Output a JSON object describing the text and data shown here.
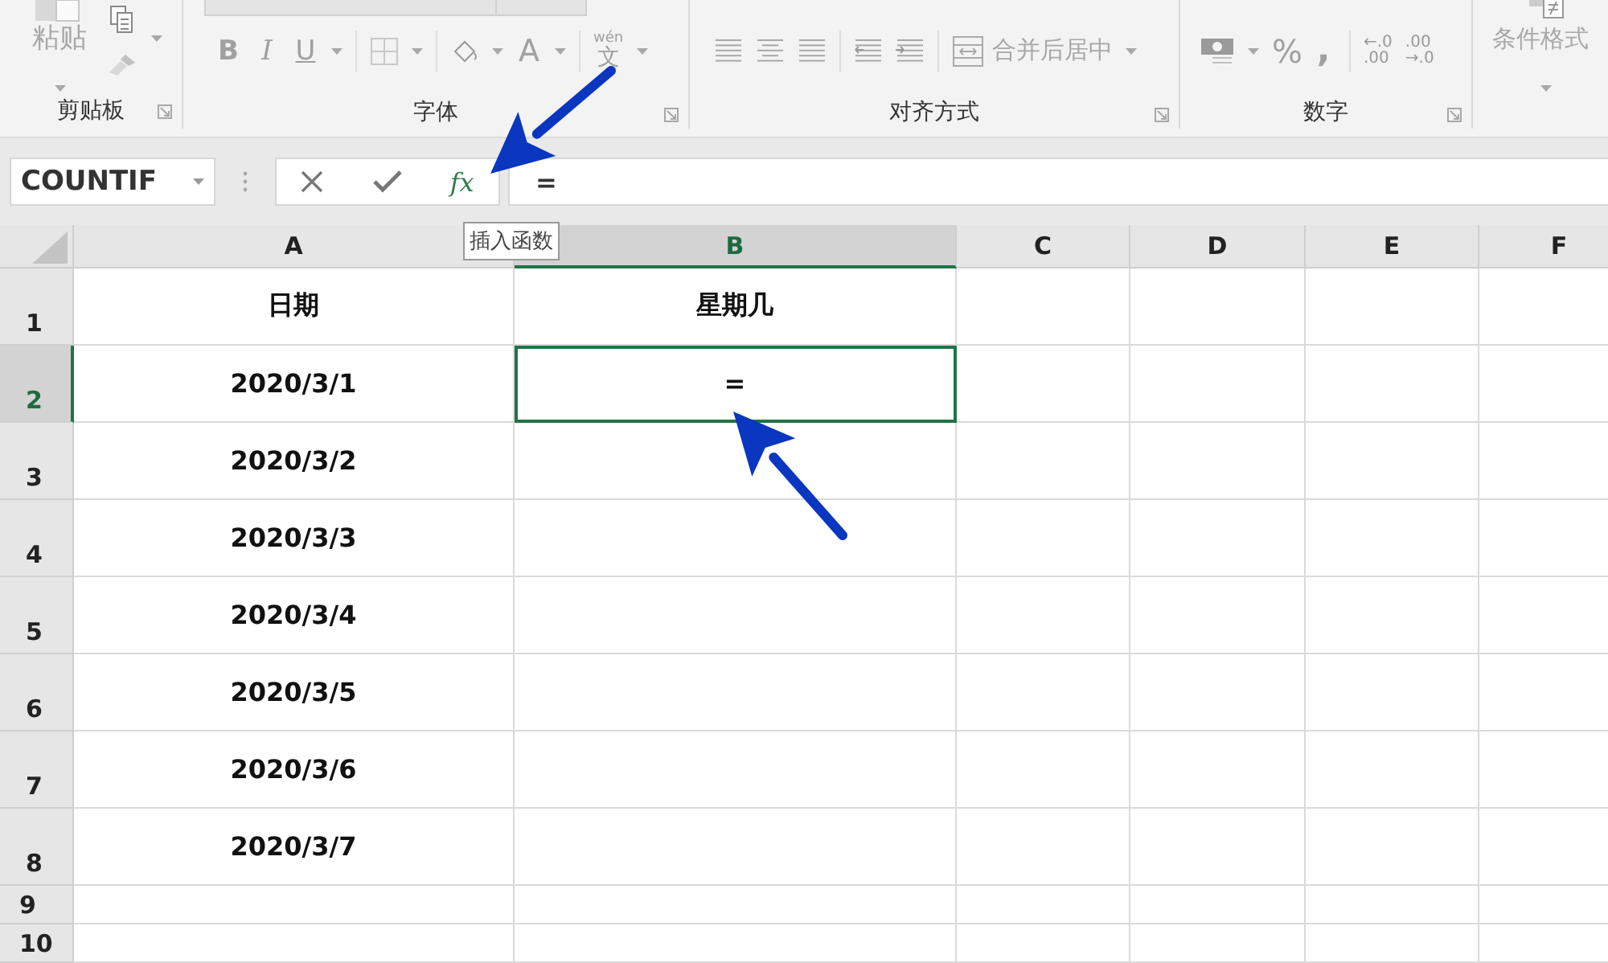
{
  "ribbon": {
    "groups": [
      {
        "kind": "clipboard",
        "label": "剪贴板",
        "paste": "粘贴"
      },
      {
        "kind": "font",
        "label": "字体",
        "bold": "B",
        "italic": "I",
        "underline": "U",
        "font_color": "A",
        "phonetic_top": "wén",
        "phonetic_char": "文"
      },
      {
        "kind": "alignment",
        "label": "对齐方式",
        "merge": "合并后居中"
      },
      {
        "kind": "number",
        "label": "数字",
        "percent": "%",
        "comma": ",",
        "increase_decimal": [
          "←.0",
          ".00"
        ],
        "decrease_decimal": [
          ".00",
          "→.0"
        ]
      },
      {
        "kind": "styles",
        "conditional": "条件格式"
      }
    ]
  },
  "formula_bar": {
    "name_box": "COUNTIF",
    "function_button": "fx",
    "formula": "=",
    "tooltip": "插入函数"
  },
  "sheet": {
    "columns": [
      {
        "label": "A",
        "selected": false
      },
      {
        "label": "B",
        "selected": true
      },
      {
        "label": "C",
        "selected": false
      },
      {
        "label": "D",
        "selected": false
      },
      {
        "label": "E",
        "selected": false
      },
      {
        "label": "F",
        "selected": false
      }
    ],
    "rows": [
      {
        "header": "1",
        "selected": false,
        "cells": [
          {
            "text": "日期",
            "selected": false
          },
          {
            "text": "星期几",
            "selected": false
          }
        ]
      },
      {
        "header": "2",
        "selected": true,
        "cells": [
          {
            "text": "2020/3/1",
            "selected": false
          },
          {
            "text": "=",
            "selected": true
          }
        ]
      },
      {
        "header": "3",
        "selected": false,
        "cells": [
          {
            "text": "2020/3/2",
            "selected": false
          }
        ]
      },
      {
        "header": "4",
        "selected": false,
        "cells": [
          {
            "text": "2020/3/3",
            "selected": false
          }
        ]
      },
      {
        "header": "5",
        "selected": false,
        "cells": [
          {
            "text": "2020/3/4",
            "selected": false
          }
        ]
      },
      {
        "header": "6",
        "selected": false,
        "cells": [
          {
            "text": "2020/3/5",
            "selected": false
          }
        ]
      },
      {
        "header": "7",
        "selected": false,
        "cells": [
          {
            "text": "2020/3/6",
            "selected": false
          }
        ]
      },
      {
        "header": "8",
        "selected": false,
        "cells": [
          {
            "text": "2020/3/7",
            "selected": false
          }
        ]
      },
      {
        "header": "9",
        "selected": false,
        "cells": []
      },
      {
        "header": "10",
        "selected": false,
        "cells": []
      }
    ]
  }
}
